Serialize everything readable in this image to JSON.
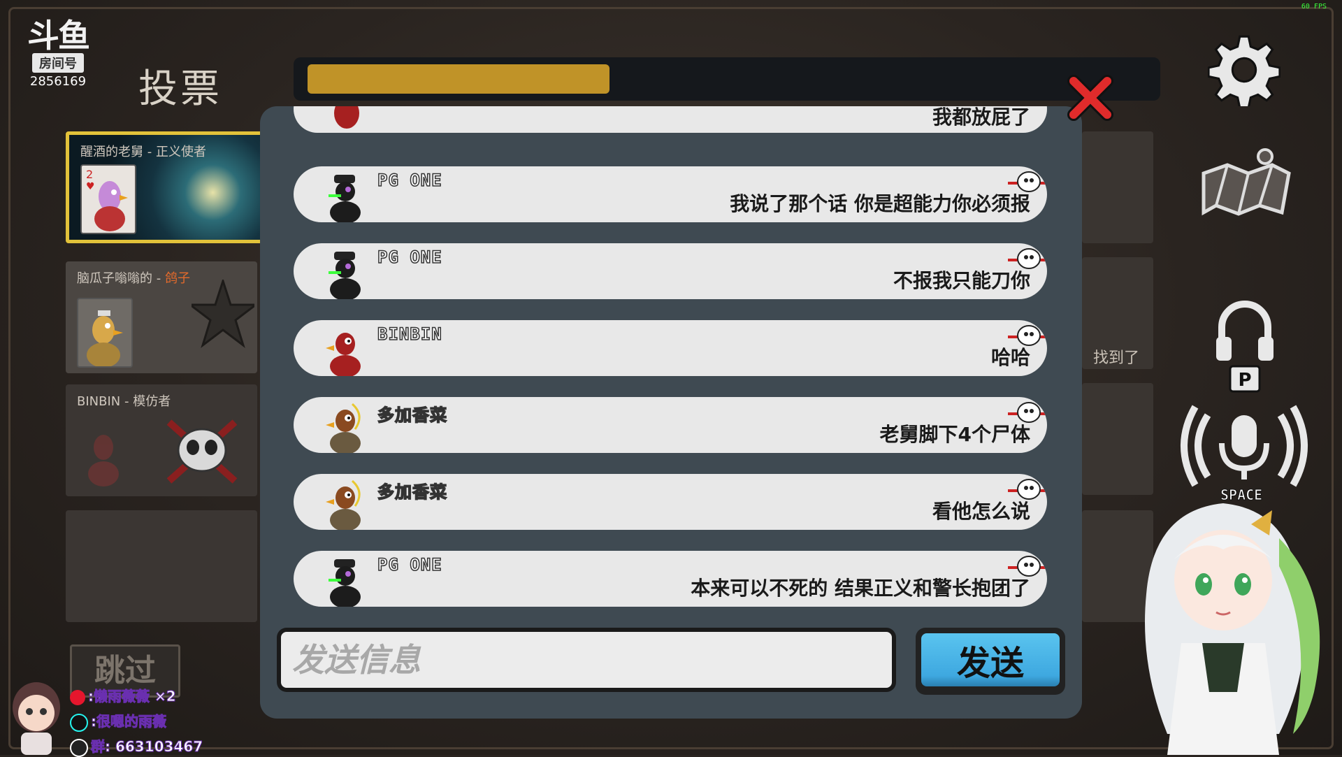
{
  "fps": "60 FPS",
  "room": {
    "brand": "斗鱼",
    "label": "房间号",
    "id": "2856169"
  },
  "vote_title": "投票",
  "timer": {
    "progress": 0.36,
    "color": "#c09328"
  },
  "players": [
    {
      "name": "醒酒的老舅",
      "role": "正义使者",
      "highlighted": true
    },
    {
      "name": "脑瓜子嗡嗡的",
      "role": "鸽子",
      "role_color": "#e36a2b"
    },
    {
      "name": "BINBIN",
      "role": "模仿者",
      "dead": true
    }
  ],
  "skip_label": "跳过",
  "right_found_text": "找到了",
  "chat": {
    "messages": [
      {
        "sender": "",
        "text": "我都放屁了",
        "avatar": "red-goose"
      },
      {
        "sender": "PG ONE",
        "text": "我说了那个话 你是超能力你必须报",
        "avatar": "black-goose"
      },
      {
        "sender": "PG ONE",
        "text": "不报我只能刀你",
        "avatar": "black-goose"
      },
      {
        "sender": "BINBIN",
        "text": "哈哈",
        "avatar": "red-goose"
      },
      {
        "sender": "多加香菜",
        "text": "老舅脚下4个尸体",
        "avatar": "brown-goose"
      },
      {
        "sender": "多加香菜",
        "text": "看他怎么说",
        "avatar": "brown-goose"
      },
      {
        "sender": "PG ONE",
        "text": "本来可以不死的 结果正义和警长抱团了",
        "avatar": "black-goose"
      }
    ],
    "input_placeholder": "发送信息",
    "input_value": "",
    "send_label": "发送"
  },
  "hotkeys": {
    "push_to_talk": "P",
    "voice": "SPACE"
  },
  "streamer_social": [
    {
      "text": ":懒雨薇薇 ×2",
      "icon": "weibo-icon"
    },
    {
      "text": ":很嗯的雨薇",
      "icon": "douyin-icon"
    },
    {
      "text": "群: 663103467",
      "icon": "qq-icon"
    }
  ],
  "colors": {
    "accent_gold": "#e2c23a",
    "send_blue": "#3ea8e0",
    "close_red": "#e02b2b"
  }
}
